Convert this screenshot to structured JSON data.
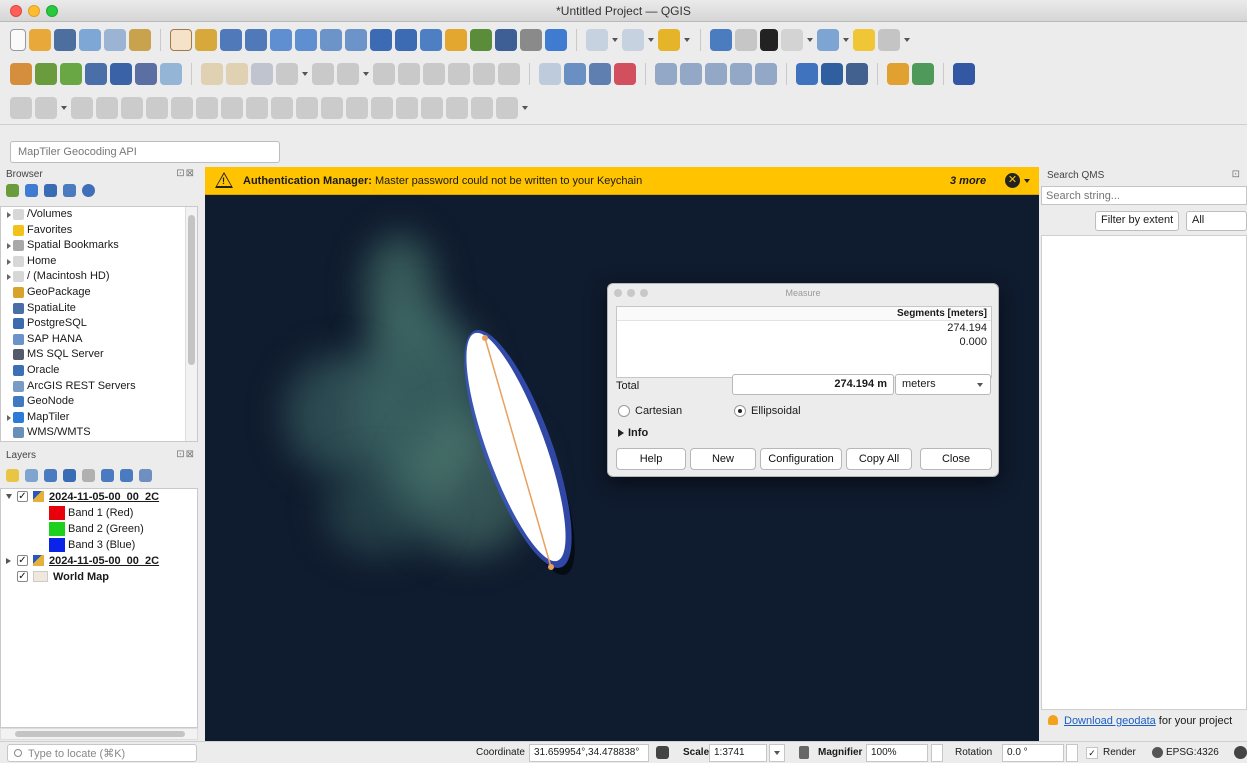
{
  "window": {
    "title": "*Untitled Project — QGIS"
  },
  "locator_bar": {
    "value": "MapTiler Geocoding API"
  },
  "browser": {
    "title": "Browser",
    "close_icons": "⊡⊠",
    "items": [
      {
        "label": "/Volumes",
        "icon": "folder-icon",
        "color": "#d7d7d7"
      },
      {
        "label": "Favorites",
        "icon": "star-icon",
        "color": "#f2c21b"
      },
      {
        "label": "Spatial Bookmarks",
        "icon": "bookmark-icon",
        "color": "#a9a9a9"
      },
      {
        "label": "Home",
        "icon": "home-icon",
        "color": "#d7d7d7"
      },
      {
        "label": "/ (Macintosh HD)",
        "icon": "folder-icon",
        "color": "#d7d7d7"
      },
      {
        "label": "GeoPackage",
        "icon": "geopackage-icon",
        "color": "#d8a32a"
      },
      {
        "label": "SpatiaLite",
        "icon": "feather-icon",
        "color": "#4a6ea8"
      },
      {
        "label": "PostgreSQL",
        "icon": "elephant-icon",
        "color": "#3c6bb0"
      },
      {
        "label": "SAP HANA",
        "icon": "database-icon",
        "color": "#6b93c9"
      },
      {
        "label": "MS SQL Server",
        "icon": "mssql-icon",
        "color": "#555a6b"
      },
      {
        "label": "Oracle",
        "icon": "oracle-icon",
        "color": "#3d6fb4"
      },
      {
        "label": "ArcGIS REST Servers",
        "icon": "globe-icon",
        "color": "#7a9bc4"
      },
      {
        "label": "GeoNode",
        "icon": "geonode-icon",
        "color": "#3f7ac0"
      },
      {
        "label": "MapTiler",
        "icon": "maptiler-icon",
        "color": "#2c7bd6"
      },
      {
        "label": "WMS/WMTS",
        "icon": "wms-icon",
        "color": "#6a8fb8"
      }
    ]
  },
  "layers": {
    "title": "Layers",
    "close_icons": "⊡⊠",
    "items": [
      {
        "label": "2024-11-05-00_00_2C",
        "kind": "raster",
        "expanded": true,
        "checked": true
      },
      {
        "label": "Band 1 (Red)",
        "kind": "band",
        "color": "#e8000b"
      },
      {
        "label": "Band 2 (Green)",
        "kind": "band",
        "color": "#1dd01d"
      },
      {
        "label": "Band 3 (Blue)",
        "kind": "band",
        "color": "#0a23e8"
      },
      {
        "label": "2024-11-05-00_00_2C",
        "kind": "raster",
        "expanded": false,
        "checked": true
      },
      {
        "label": "World Map",
        "kind": "vector",
        "checked": true,
        "color": "#efe9dc"
      }
    ]
  },
  "message_bar": {
    "title": "Authentication Manager:",
    "text": " Master password could not be written to your Keychain",
    "more": "3 more",
    "dismiss": "✕"
  },
  "measure": {
    "title": "Measure",
    "segments_header": "Segments [meters]",
    "segments": [
      "274.194",
      "0.000"
    ],
    "total_label": "Total",
    "total_value": "274.194 m",
    "units": "meters",
    "cartesian_label": "Cartesian",
    "ellipsoidal_label": "Ellipsoidal",
    "selected_mode": "ellipsoidal",
    "info_label": "Info",
    "buttons": {
      "help": "Help",
      "new": "New",
      "configuration": "Configuration",
      "copy_all": "Copy All",
      "close": "Close"
    }
  },
  "qms": {
    "title": "Search QMS",
    "close_icons": "⊡",
    "search_placeholder": "Search string...",
    "filter_button": "Filter by extent",
    "filter_select": "All",
    "download_link": "Download geodata",
    "download_text": " for your project"
  },
  "statusbar": {
    "locate_placeholder": "Type to locate (⌘K)",
    "coordinate_label": "Coordinate",
    "coordinate_value": "31.659954°,34.478838°",
    "scale_label": "Scale",
    "scale_value": "1:3741",
    "magnifier_label": "Magnifier",
    "magnifier_value": "100%",
    "rotation_label": "Rotation",
    "rotation_value": "0.0 °",
    "render_label": "Render",
    "crs_label": "EPSG:4326"
  },
  "colors": {
    "accent_warning": "#ffc300",
    "map_background": "#0f1b2e",
    "measure_line": "#e8a060"
  }
}
